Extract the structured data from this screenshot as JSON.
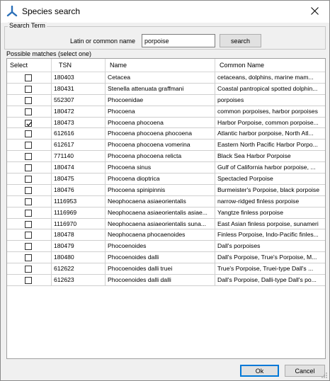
{
  "window": {
    "title": "Species search",
    "app_icon": "tree-icon",
    "close_icon": "close-icon"
  },
  "search": {
    "group_label": "Search Term",
    "field_label": "Latin or common name",
    "value": "porpoise",
    "button_label": "search"
  },
  "matches": {
    "label": "Possible matches (select one)",
    "columns": [
      "Select",
      "TSN",
      "Name",
      "Common Name"
    ],
    "rows": [
      {
        "checked": false,
        "tsn": "180403",
        "name": "Cetacea",
        "common": "cetaceans, dolphins, marine mam..."
      },
      {
        "checked": false,
        "tsn": "180431",
        "name": "Stenella attenuata graffmani",
        "common": "Coastal pantropical spotted dolphin..."
      },
      {
        "checked": false,
        "tsn": "552307",
        "name": "Phocoenidae",
        "common": "porpoises"
      },
      {
        "checked": false,
        "tsn": "180472",
        "name": "Phocoena",
        "common": "common porpoises, harbor porpoises"
      },
      {
        "checked": true,
        "tsn": "180473",
        "name": "Phocoena phocoena",
        "common": "Harbor Porpoise, common porpoise..."
      },
      {
        "checked": false,
        "tsn": "612616",
        "name": "Phocoena phocoena phocoena",
        "common": "Atlantic harbor porpoise, North Atl..."
      },
      {
        "checked": false,
        "tsn": "612617",
        "name": "Phocoena phocoena vomerina",
        "common": "Eastern North Pacific Harbor Porpo..."
      },
      {
        "checked": false,
        "tsn": "771140",
        "name": "Phocoena phocoena relicta",
        "common": "Black Sea Harbor Porpoise"
      },
      {
        "checked": false,
        "tsn": "180474",
        "name": "Phocoena sinus",
        "common": "Gulf of California harbor porpoise, ..."
      },
      {
        "checked": false,
        "tsn": "180475",
        "name": "Phocoena dioptrica",
        "common": "Spectacled Porpoise"
      },
      {
        "checked": false,
        "tsn": "180476",
        "name": "Phocoena spinipinnis",
        "common": "Burmeister's Porpoise, black porpoise"
      },
      {
        "checked": false,
        "tsn": "1116953",
        "name": "Neophocaena asiaeorientalis",
        "common": "narrow-ridged finless porpoise"
      },
      {
        "checked": false,
        "tsn": "1116969",
        "name": "Neophocaena asiaeorientalis asiae...",
        "common": "Yangtze finless porpoise"
      },
      {
        "checked": false,
        "tsn": "1116970",
        "name": "Neophocaena asiaeorientalis suna...",
        "common": "East Asian finless porpoise, sunameri"
      },
      {
        "checked": false,
        "tsn": "180478",
        "name": "Neophocaena phocaenoides",
        "common": "Finless Porpoise, Indo-Pacific finles..."
      },
      {
        "checked": false,
        "tsn": "180479",
        "name": "Phocoenoides",
        "common": "Dall's porpoises"
      },
      {
        "checked": false,
        "tsn": "180480",
        "name": "Phocoenoides dalli",
        "common": "Dall's Porpoise, True's Porpoise, M..."
      },
      {
        "checked": false,
        "tsn": "612622",
        "name": "Phocoenoides dalli truei",
        "common": "True's Porpoise, Truei-type Dall's ..."
      },
      {
        "checked": false,
        "tsn": "612623",
        "name": "Phocoenoides dalli dalli",
        "common": "Dall's Porpoise, Dalli-type Dall's po..."
      }
    ]
  },
  "footer": {
    "ok_label": "Ok",
    "cancel_label": "Cancel"
  }
}
